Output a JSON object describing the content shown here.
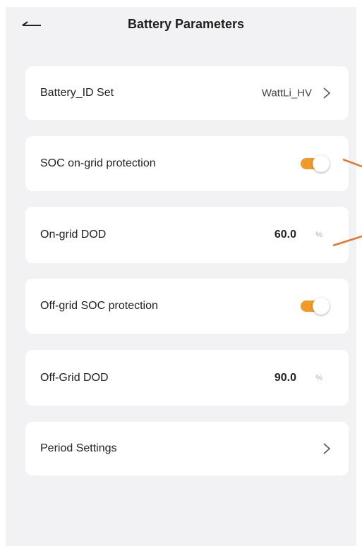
{
  "header": {
    "title": "Battery Parameters"
  },
  "rows": {
    "battery_id": {
      "label": "Battery_ID Set",
      "value": "WattLi_HV"
    },
    "soc_on_grid": {
      "label": "SOC on-grid protection",
      "enabled": true
    },
    "on_grid_dod": {
      "label": "On-grid DOD",
      "value": "60.0",
      "unit": "%"
    },
    "off_grid_soc": {
      "label": "Off-grid SOC protection",
      "enabled": true
    },
    "off_grid_dod": {
      "label": "Off-Grid DOD",
      "value": "90.0",
      "unit": "%"
    },
    "period": {
      "label": "Period Settings"
    }
  },
  "colors": {
    "accent": "#f29a28",
    "annotation_line": "#e8742a",
    "background": "#f2f2f4",
    "card": "#ffffff"
  },
  "icons": {
    "back": "back-arrow-icon",
    "chevron": "chevron-right-icon"
  }
}
